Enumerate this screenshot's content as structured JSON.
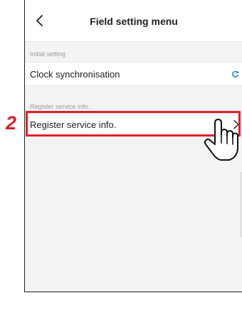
{
  "header": {
    "title": "Field setting menu",
    "back_icon": "chevron-left-icon"
  },
  "sections": [
    {
      "label": "Initial setting",
      "items": [
        {
          "label": "Clock synchronisation",
          "icon": "sync-icon"
        }
      ]
    },
    {
      "label": "Register service info.",
      "items": [
        {
          "label": "Register service info.",
          "icon": "chevron-right-icon"
        }
      ]
    }
  ],
  "annotation": {
    "step": "2",
    "highlight_color": "#e0202a",
    "pointer_icon": "hand-pointer-icon"
  },
  "colors": {
    "accent": "#2a7dd1",
    "background": "#f4f4f4"
  }
}
